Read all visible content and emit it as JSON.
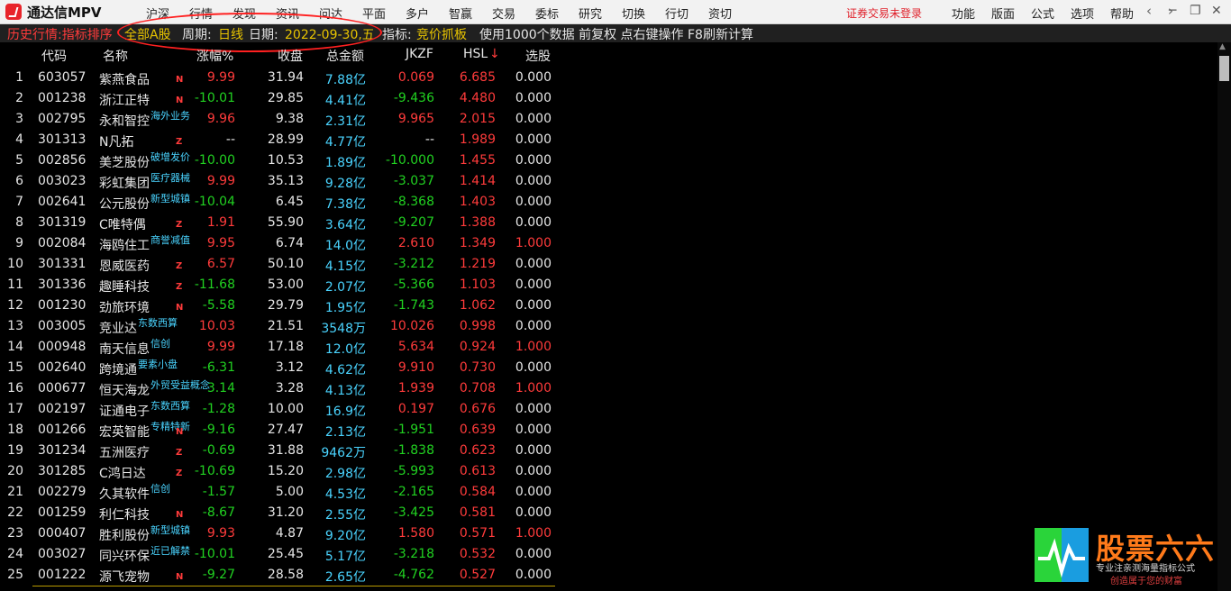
{
  "app": {
    "title": "通达信MPV"
  },
  "menu": [
    "沪深",
    "行情",
    "发现",
    "资讯",
    "问达",
    "平面",
    "多户",
    "智赢",
    "交易",
    "委标",
    "研究",
    "切换",
    "行切",
    "资切"
  ],
  "top_notice": "证券交易未登录",
  "right_menu": [
    "功能",
    "版面",
    "公式",
    "选项",
    "帮助"
  ],
  "nav": {
    "back": "‹",
    "forward": "›"
  },
  "window": {
    "minimize": "─",
    "restore": "❐",
    "close": "✕"
  },
  "info_bar": {
    "history": "历史行情:指标排序",
    "market": "全部A股",
    "period_label": "周期:",
    "period": "日线",
    "date_label": "日期:",
    "date": "2022-09-30,五",
    "indicator_label": "指标:",
    "indicator": "竞价抓板",
    "extra": "使用1000个数据 前复权 点右键操作 F8刷新计算"
  },
  "columns": {
    "code": "代码",
    "name": "名称",
    "change": "涨幅%",
    "close": "收盘",
    "amount": "总金额",
    "jkzf": "JKZF",
    "hsl": "HSL",
    "hsl_sort": "↓",
    "xg": "选股"
  },
  "colors": {
    "up": "#ff3b3b",
    "down": "#21d121",
    "flat": "#e6e6e6",
    "amount": "#4ad4ff",
    "tag": "#4ad4ff"
  },
  "rows": [
    {
      "i": "1",
      "code": "603057",
      "name": "紫燕食品",
      "tag": "",
      "flag": "N",
      "zf": "9.99",
      "zfd": "up",
      "sp": "31.94",
      "je": "7.88亿",
      "jk": "0.069",
      "jkd": "up",
      "hs": "6.685",
      "xg": "0.000",
      "xgd": "eq"
    },
    {
      "i": "2",
      "code": "001238",
      "name": "浙江正特",
      "tag": "",
      "flag": "N",
      "zf": "-10.01",
      "zfd": "dn",
      "sp": "29.85",
      "je": "4.41亿",
      "jk": "-9.436",
      "jkd": "dn",
      "hs": "4.480",
      "xg": "0.000",
      "xgd": "eq"
    },
    {
      "i": "3",
      "code": "002795",
      "name": "永和智控",
      "tag": "海外业务",
      "flag": "",
      "zf": "9.96",
      "zfd": "up",
      "sp": "9.38",
      "je": "2.31亿",
      "jk": "9.965",
      "jkd": "up",
      "hs": "2.015",
      "xg": "0.000",
      "xgd": "eq"
    },
    {
      "i": "4",
      "code": "301313",
      "name": "N凡拓",
      "tag": "",
      "flag": "Z",
      "zf": "--",
      "zfd": "eq",
      "sp": "28.99",
      "je": "4.77亿",
      "jk": "--",
      "jkd": "eq",
      "hs": "1.989",
      "xg": "0.000",
      "xgd": "eq"
    },
    {
      "i": "5",
      "code": "002856",
      "name": "美芝股份",
      "tag": "破增发价",
      "flag": "",
      "zf": "-10.00",
      "zfd": "dn",
      "sp": "10.53",
      "je": "1.89亿",
      "jk": "-10.000",
      "jkd": "dn",
      "hs": "1.455",
      "xg": "0.000",
      "xgd": "eq"
    },
    {
      "i": "6",
      "code": "003023",
      "name": "彩虹集团",
      "tag": "医疗器械",
      "flag": "",
      "zf": "9.99",
      "zfd": "up",
      "sp": "35.13",
      "je": "9.28亿",
      "jk": "-3.037",
      "jkd": "dn",
      "hs": "1.414",
      "xg": "0.000",
      "xgd": "eq"
    },
    {
      "i": "7",
      "code": "002641",
      "name": "公元股份",
      "tag": "新型城镇",
      "flag": "",
      "zf": "-10.04",
      "zfd": "dn",
      "sp": "6.45",
      "je": "7.38亿",
      "jk": "-8.368",
      "jkd": "dn",
      "hs": "1.403",
      "xg": "0.000",
      "xgd": "eq"
    },
    {
      "i": "8",
      "code": "301319",
      "name": "C唯特偶",
      "tag": "",
      "flag": "Z",
      "zf": "1.91",
      "zfd": "up",
      "sp": "55.90",
      "je": "3.64亿",
      "jk": "-9.207",
      "jkd": "dn",
      "hs": "1.388",
      "xg": "0.000",
      "xgd": "eq"
    },
    {
      "i": "9",
      "code": "002084",
      "name": "海鸥住工",
      "tag": "商誉减值",
      "flag": "",
      "zf": "9.95",
      "zfd": "up",
      "sp": "6.74",
      "je": "14.0亿",
      "jk": "2.610",
      "jkd": "up",
      "hs": "1.349",
      "xg": "1.000",
      "xgd": "up"
    },
    {
      "i": "10",
      "code": "301331",
      "name": "恩威医药",
      "tag": "",
      "flag": "Z",
      "zf": "6.57",
      "zfd": "up",
      "sp": "50.10",
      "je": "4.15亿",
      "jk": "-3.212",
      "jkd": "dn",
      "hs": "1.219",
      "xg": "0.000",
      "xgd": "eq"
    },
    {
      "i": "11",
      "code": "301336",
      "name": "趣睡科技",
      "tag": "",
      "flag": "Z",
      "zf": "-11.68",
      "zfd": "dn",
      "sp": "53.00",
      "je": "2.07亿",
      "jk": "-5.366",
      "jkd": "dn",
      "hs": "1.103",
      "xg": "0.000",
      "xgd": "eq"
    },
    {
      "i": "12",
      "code": "001230",
      "name": "劲旅环境",
      "tag": "",
      "flag": "N",
      "zf": "-5.58",
      "zfd": "dn",
      "sp": "29.79",
      "je": "1.95亿",
      "jk": "-1.743",
      "jkd": "dn",
      "hs": "1.062",
      "xg": "0.000",
      "xgd": "eq"
    },
    {
      "i": "13",
      "code": "003005",
      "name": "竞业达",
      "tag": "东数西算",
      "flag": "",
      "zf": "10.03",
      "zfd": "up",
      "sp": "21.51",
      "je": "3548万",
      "jk": "10.026",
      "jkd": "up",
      "hs": "0.998",
      "xg": "0.000",
      "xgd": "eq"
    },
    {
      "i": "14",
      "code": "000948",
      "name": "南天信息",
      "tag": "信创",
      "flag": "",
      "zf": "9.99",
      "zfd": "up",
      "sp": "17.18",
      "je": "12.0亿",
      "jk": "5.634",
      "jkd": "up",
      "hs": "0.924",
      "xg": "1.000",
      "xgd": "up"
    },
    {
      "i": "15",
      "code": "002640",
      "name": "跨境通",
      "tag": "要素小盘",
      "flag": "",
      "zf": "-6.31",
      "zfd": "dn",
      "sp": "3.12",
      "je": "4.62亿",
      "jk": "9.910",
      "jkd": "up",
      "hs": "0.730",
      "xg": "0.000",
      "xgd": "eq"
    },
    {
      "i": "16",
      "code": "000677",
      "name": "恒天海龙",
      "tag": "外贸受益概念",
      "flag": "",
      "zf": "3.14",
      "zfd": "dn",
      "sp": "3.28",
      "je": "4.13亿",
      "jk": "1.939",
      "jkd": "up",
      "hs": "0.708",
      "xg": "1.000",
      "xgd": "up"
    },
    {
      "i": "17",
      "code": "002197",
      "name": "证通电子",
      "tag": "东数西算",
      "flag": "",
      "zf": "-1.28",
      "zfd": "dn",
      "sp": "10.00",
      "je": "16.9亿",
      "jk": "0.197",
      "jkd": "up",
      "hs": "0.676",
      "xg": "0.000",
      "xgd": "eq"
    },
    {
      "i": "18",
      "code": "001266",
      "name": "宏英智能",
      "tag": "专精特新",
      "flag": "N",
      "zf": "-9.16",
      "zfd": "dn",
      "sp": "27.47",
      "je": "2.13亿",
      "jk": "-1.951",
      "jkd": "dn",
      "hs": "0.639",
      "xg": "0.000",
      "xgd": "eq"
    },
    {
      "i": "19",
      "code": "301234",
      "name": "五洲医疗",
      "tag": "",
      "flag": "Z",
      "zf": "-0.69",
      "zfd": "dn",
      "sp": "31.88",
      "je": "9462万",
      "jk": "-1.838",
      "jkd": "dn",
      "hs": "0.623",
      "xg": "0.000",
      "xgd": "eq"
    },
    {
      "i": "20",
      "code": "301285",
      "name": "C鸿日达",
      "tag": "",
      "flag": "Z",
      "zf": "-10.69",
      "zfd": "dn",
      "sp": "15.20",
      "je": "2.98亿",
      "jk": "-5.993",
      "jkd": "dn",
      "hs": "0.613",
      "xg": "0.000",
      "xgd": "eq"
    },
    {
      "i": "21",
      "code": "002279",
      "name": "久其软件",
      "tag": "信创",
      "flag": "",
      "zf": "-1.57",
      "zfd": "dn",
      "sp": "5.00",
      "je": "4.53亿",
      "jk": "-2.165",
      "jkd": "dn",
      "hs": "0.584",
      "xg": "0.000",
      "xgd": "eq"
    },
    {
      "i": "22",
      "code": "001259",
      "name": "利仁科技",
      "tag": "",
      "flag": "N",
      "zf": "-8.67",
      "zfd": "dn",
      "sp": "31.20",
      "je": "2.55亿",
      "jk": "-3.425",
      "jkd": "dn",
      "hs": "0.581",
      "xg": "0.000",
      "xgd": "eq"
    },
    {
      "i": "23",
      "code": "000407",
      "name": "胜利股份",
      "tag": "新型城镇",
      "flag": "",
      "zf": "9.93",
      "zfd": "up",
      "sp": "4.87",
      "je": "9.20亿",
      "jk": "1.580",
      "jkd": "up",
      "hs": "0.571",
      "xg": "1.000",
      "xgd": "up"
    },
    {
      "i": "24",
      "code": "003027",
      "name": "同兴环保",
      "tag": "近已解禁",
      "flag": "",
      "zf": "-10.01",
      "zfd": "dn",
      "sp": "25.45",
      "je": "5.17亿",
      "jk": "-3.218",
      "jkd": "dn",
      "hs": "0.532",
      "xg": "0.000",
      "xgd": "eq"
    },
    {
      "i": "25",
      "code": "001222",
      "name": "源飞宠物",
      "tag": "",
      "flag": "N",
      "zf": "-9.27",
      "zfd": "dn",
      "sp": "28.58",
      "je": "2.65亿",
      "jk": "-4.762",
      "jkd": "dn",
      "hs": "0.527",
      "xg": "0.000",
      "xgd": "eq"
    }
  ],
  "watermark": {
    "title": "股票六六",
    "line1": "专业注亲测海量指标公式",
    "line2": "创造属于您的财富"
  }
}
